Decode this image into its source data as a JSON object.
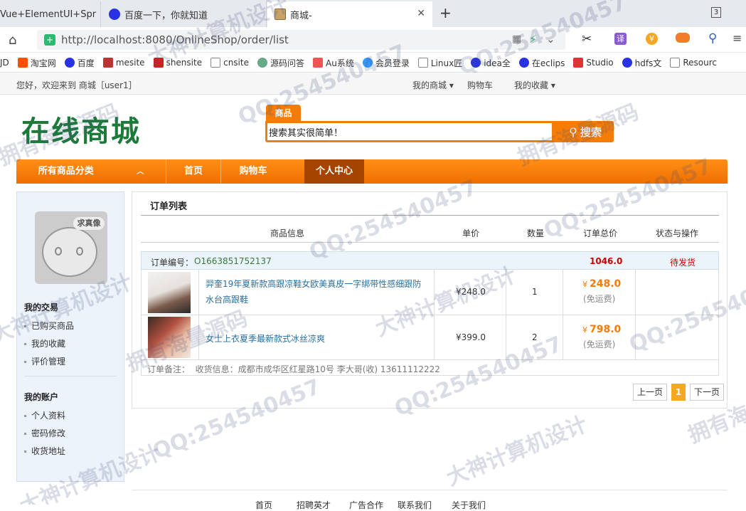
{
  "browser": {
    "tabs": [
      {
        "title": "Vue+ElementUI+Spr"
      },
      {
        "title": "百度一下，你就知道"
      },
      {
        "title": "商城-"
      }
    ],
    "new_tab": "+",
    "tab_count": "3",
    "url": "http://localhost:8080/OnlineShop/order/list",
    "bookmarks": [
      "JD",
      "淘宝网",
      "百度",
      "mesite",
      "shensite",
      "cnsite",
      "源码问答",
      "Au系统",
      "会员登录",
      "Linux匠",
      "idea全",
      "在eclips",
      "Studio",
      "hdfs文",
      "Resourc"
    ]
  },
  "site": {
    "welcome": "您好，欢迎来到 商城［user1］",
    "top_links": [
      "我的商城",
      "购物车",
      "我的收藏"
    ],
    "logo": "在线商城",
    "search": {
      "tab": "商品",
      "value": "搜索其实很简单！",
      "button": "搜索"
    },
    "nav": {
      "categories": "所有商品分类",
      "items": [
        "首页",
        "购物车",
        "个人中心"
      ]
    },
    "sidebar": {
      "avatar_text": "求真像",
      "sections": [
        {
          "title": "我的交易",
          "items": [
            "已购买商品",
            "我的收藏",
            "评价管理"
          ]
        },
        {
          "title": "我的账户",
          "items": [
            "个人资料",
            "密码修改",
            "收货地址"
          ]
        }
      ]
    },
    "orders": {
      "title": "订单列表",
      "headers": [
        "商品信息",
        "单价",
        "数量",
        "订单总价",
        "状态与操作"
      ],
      "order_no_label": "订单编号：",
      "order_no": "O1663851752137",
      "order_total": "1046.0",
      "status": "待发货",
      "items": [
        {
          "name": "羿奎19年夏新款高跟凉鞋女欧美真皮一字绑带性感细跟防水台高跟鞋",
          "price": "¥248.0",
          "qty": "1",
          "total_symbol": "¥",
          "total": "248.0",
          "shipping": "(免运费)"
        },
        {
          "name": "女士上衣夏季最新款式冰丝凉爽",
          "price": "¥399.0",
          "qty": "2",
          "total_symbol": "¥",
          "total": "798.0",
          "shipping": "(免运费)"
        }
      ],
      "remark": "订单备注：  收货信息：成都市成华区红星路10号 李大哥(收) 13611112222",
      "pager": {
        "prev": "上一页",
        "current": "1",
        "next": "下一页"
      }
    },
    "footer_links": [
      "首页",
      "招聘英才",
      "广告合作",
      "联系我们",
      "关于我们"
    ]
  },
  "watermarks": [
    "QQ:254540457",
    "大神计算机设计",
    "拥有海量源码"
  ],
  "colors": {
    "accent": "#f47c07",
    "nav_active": "#a54400",
    "logo": "#1d7a3a",
    "price": "#f47c07",
    "status": "#c00",
    "link": "#2a6f9e"
  }
}
